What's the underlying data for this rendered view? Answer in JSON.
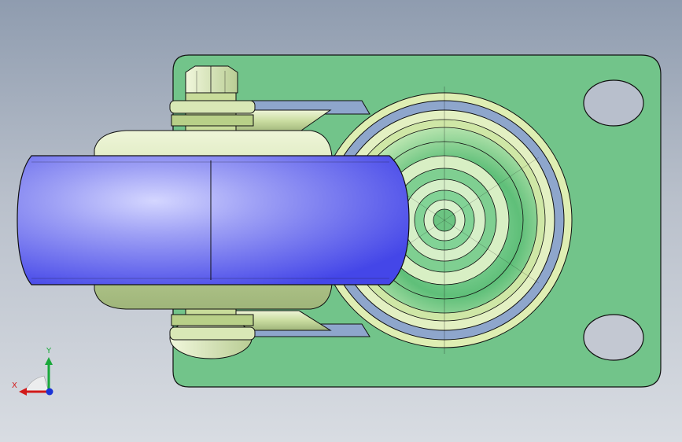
{
  "viewport": {
    "background_top": "#8f9caf",
    "background_bottom": "#d8dce2"
  },
  "model": {
    "name": "caster-wheel-assembly",
    "parts": [
      "mounting-plate",
      "swivel-bearing",
      "fork",
      "wheel",
      "axle-bolt",
      "hex-nut"
    ],
    "colors": {
      "mounting_plate": "#72c48a",
      "swivel_ring_blue": "#8ea6cc",
      "fork_light": "#dbe9b3",
      "wheel": "#7a7cf0",
      "outline": "#101010"
    }
  },
  "triad": {
    "x_label": "X",
    "y_label": "Y",
    "x_color": "#d11a1a",
    "y_color": "#19a83a",
    "z_color": "#1a33d6"
  }
}
